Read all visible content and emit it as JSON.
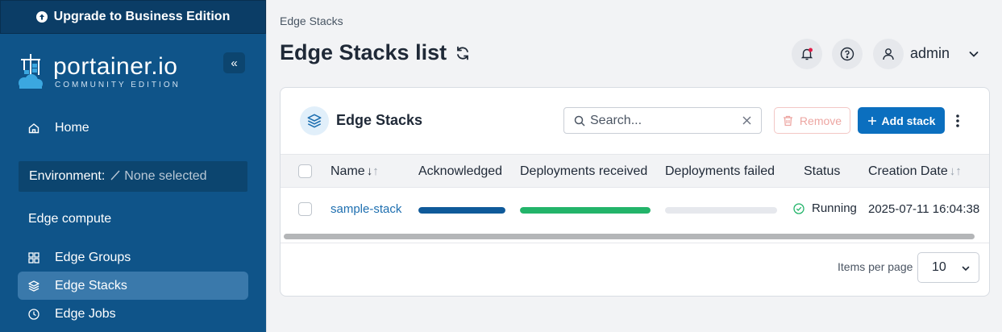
{
  "sidebar": {
    "upgrade_label": "Upgrade to Business Edition",
    "brand": "portainer.io",
    "edition": "COMMUNITY EDITION",
    "collapse_label": "«",
    "home_label": "Home",
    "environment_label": "Environment:",
    "environment_value": "None selected",
    "section_title": "Edge compute",
    "items": [
      {
        "label": "Edge Groups",
        "icon": "grid-icon"
      },
      {
        "label": "Edge Stacks",
        "icon": "layers-icon",
        "active": true
      },
      {
        "label": "Edge Jobs",
        "icon": "clock-icon"
      }
    ]
  },
  "header": {
    "breadcrumb": "Edge Stacks",
    "title": "Edge Stacks list",
    "user_name": "admin"
  },
  "card": {
    "title": "Edge Stacks",
    "search_placeholder": "Search...",
    "remove_label": "Remove",
    "add_label": "Add stack",
    "columns": [
      "Name",
      "Acknowledged",
      "Deployments received",
      "Deployments failed",
      "Status",
      "Creation Date"
    ],
    "rows": [
      {
        "name": "sample-stack",
        "acknowledged": 1.0,
        "deployments_received": 1.0,
        "deployments_failed": 0.0,
        "status": "Running",
        "creation_date": "2025-07-11 16:04:38"
      }
    ],
    "items_per_page_label": "Items per page",
    "items_per_page_value": "10"
  },
  "colors": {
    "sidebar_bg": "#0f5489",
    "accent": "#0b6fbf",
    "acknowledged_bar": "#0f5a9a",
    "received_bar": "#23b46a",
    "status_ok": "#23b46a",
    "notification_dot": "#e11d48"
  }
}
